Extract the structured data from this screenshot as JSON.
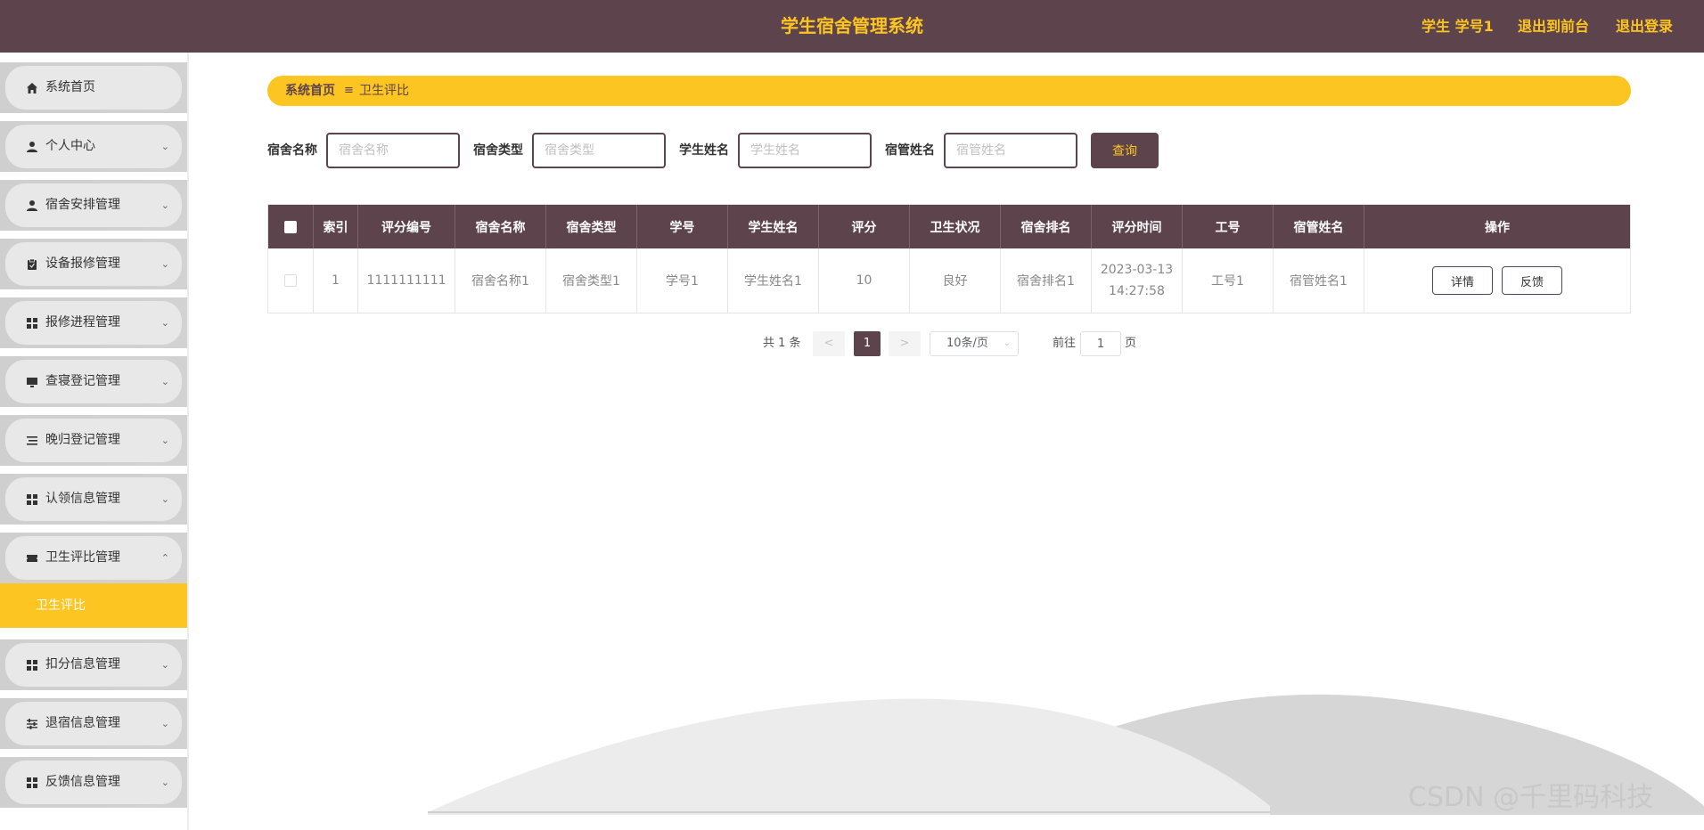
{
  "header": {
    "title": "学生宿舍管理系统",
    "user": "学生 学号1",
    "front_link": "退出到前台",
    "logout_link": "退出登录",
    "bg_color": "#5d434c",
    "accent_color": "#fdc521"
  },
  "sidebar": {
    "items": [
      {
        "label": "系统首页",
        "icon": "home-icon"
      },
      {
        "label": "个人中心",
        "icon": "user-icon"
      },
      {
        "label": "宿舍安排管理",
        "icon": "user-icon"
      },
      {
        "label": "设备报修管理",
        "icon": "clipboard-icon"
      },
      {
        "label": "报修进程管理",
        "icon": "grid-icon"
      },
      {
        "label": "查寝登记管理",
        "icon": "monitor-icon"
      },
      {
        "label": "晚归登记管理",
        "icon": "list-icon"
      },
      {
        "label": "认领信息管理",
        "icon": "grid-icon"
      },
      {
        "label": "卫生评比管理",
        "icon": "ticket-icon"
      },
      {
        "label": "扣分信息管理",
        "icon": "grid-icon"
      },
      {
        "label": "退宿信息管理",
        "icon": "sliders-icon"
      },
      {
        "label": "反馈信息管理",
        "icon": "grid-icon"
      }
    ],
    "active_sub": "卫生评比"
  },
  "breadcrumb": {
    "home": "系统首页",
    "current": "卫生评比"
  },
  "search": {
    "fields": [
      {
        "label": "宿舍名称",
        "placeholder": "宿舍名称"
      },
      {
        "label": "宿舍类型",
        "placeholder": "宿舍类型"
      },
      {
        "label": "学生姓名",
        "placeholder": "学生姓名"
      },
      {
        "label": "宿管姓名",
        "placeholder": "宿管姓名"
      }
    ],
    "button": "查询"
  },
  "table": {
    "columns": [
      "索引",
      "评分编号",
      "宿舍名称",
      "宿舍类型",
      "学号",
      "学生姓名",
      "评分",
      "卫生状况",
      "宿舍排名",
      "评分时间",
      "工号",
      "宿管姓名",
      "操作"
    ],
    "rows": [
      {
        "index": "1",
        "score_no": "1111111111",
        "dorm_name": "宿舍名称1",
        "dorm_type": "宿舍类型1",
        "student_no": "学号1",
        "student_name": "学生姓名1",
        "score": "10",
        "hygiene": "良好",
        "rank": "宿舍排名1",
        "time_date": "2023-03-13",
        "time_clock": "14:27:58",
        "staff_no": "工号1",
        "manager_name": "宿管姓名1",
        "actions": [
          "详情",
          "反馈"
        ]
      }
    ]
  },
  "pagination": {
    "total": "共 1 条",
    "prev": "<",
    "current": "1",
    "next": ">",
    "page_size": "10条/页",
    "goto_label": "前往",
    "goto_value": "1",
    "page_unit": "页"
  },
  "watermark": "CSDN @千里码科技"
}
